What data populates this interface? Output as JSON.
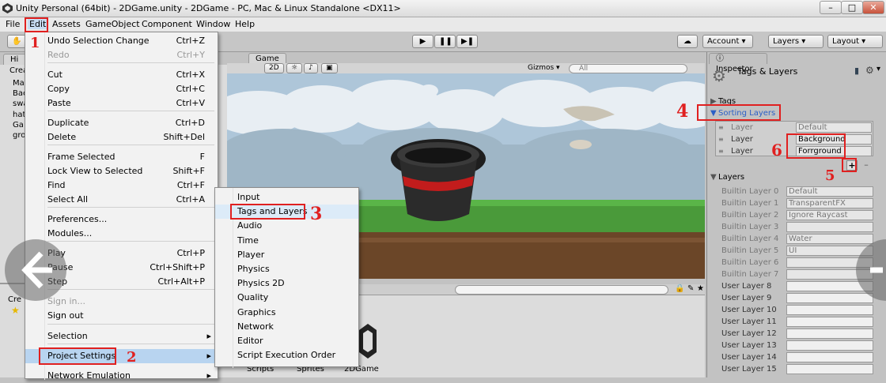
{
  "window": {
    "title": "Unity Personal (64bit) - 2DGame.unity - 2DGame - PC, Mac & Linux Standalone <DX11>",
    "min": "–",
    "max": "□",
    "close": "✕"
  },
  "menubar": [
    "File",
    "Edit",
    "Assets",
    "GameObject",
    "Component",
    "Window",
    "Help"
  ],
  "toolbar": {
    "account": "Account ▾",
    "layers": "Layers ▾",
    "layout": "Layout ▾"
  },
  "tabs": {
    "hierarchy": "Hi",
    "game": "Game",
    "inspector": "Inspector"
  },
  "gamebar": {
    "mode": "2D",
    "gizmos": "Gizmos ▾",
    "search": "All"
  },
  "hierarchy_fragments": [
    "Crea",
    "Ma",
    "Bac",
    "swa",
    "hat",
    "Ga",
    "gro"
  ],
  "project_fragments": [
    "Cre"
  ],
  "edit_menu": [
    {
      "label": "Undo Selection Change",
      "shortcut": "Ctrl+Z",
      "enabled": true
    },
    {
      "label": "Redo",
      "shortcut": "Ctrl+Y",
      "enabled": false
    },
    {
      "label": "Cut",
      "shortcut": "Ctrl+X",
      "enabled": true
    },
    {
      "label": "Copy",
      "shortcut": "Ctrl+C",
      "enabled": true
    },
    {
      "label": "Paste",
      "shortcut": "Ctrl+V",
      "enabled": true
    },
    {
      "label": "Duplicate",
      "shortcut": "Ctrl+D",
      "enabled": true
    },
    {
      "label": "Delete",
      "shortcut": "Shift+Del",
      "enabled": true
    },
    {
      "label": "Frame Selected",
      "shortcut": "F",
      "enabled": true
    },
    {
      "label": "Lock View to Selected",
      "shortcut": "Shift+F",
      "enabled": true
    },
    {
      "label": "Find",
      "shortcut": "Ctrl+F",
      "enabled": true
    },
    {
      "label": "Select All",
      "shortcut": "Ctrl+A",
      "enabled": true
    },
    {
      "label": "Preferences...",
      "shortcut": "",
      "enabled": true
    },
    {
      "label": "Modules...",
      "shortcut": "",
      "enabled": true
    },
    {
      "label": "Play",
      "shortcut": "Ctrl+P",
      "enabled": true
    },
    {
      "label": "Pause",
      "shortcut": "Ctrl+Shift+P",
      "enabled": true
    },
    {
      "label": "Step",
      "shortcut": "Ctrl+Alt+P",
      "enabled": true
    },
    {
      "label": "Sign in...",
      "shortcut": "",
      "enabled": false
    },
    {
      "label": "Sign out",
      "shortcut": "",
      "enabled": true
    },
    {
      "label": "Selection",
      "shortcut": "▸",
      "enabled": true
    },
    {
      "label": "Project Settings",
      "shortcut": "▸",
      "enabled": true
    },
    {
      "label": "Network Emulation",
      "shortcut": "▸",
      "enabled": true
    }
  ],
  "project_settings_menu": [
    "Input",
    "Tags and Layers",
    "Audio",
    "Time",
    "Player",
    "Physics",
    "Physics 2D",
    "Quality",
    "Graphics",
    "Network",
    "Editor",
    "Script Execution Order"
  ],
  "project_folders": [
    "Scripts",
    "Sprites",
    "2DGame"
  ],
  "inspector": {
    "title": "Tags & Layers",
    "tags_label": "Tags",
    "sorting_layers_label": "Sorting Layers",
    "sorting_layers": [
      {
        "label": "Layer",
        "value": "Default",
        "dim": true
      },
      {
        "label": "Layer",
        "value": "Background",
        "dim": false
      },
      {
        "label": "Layer",
        "value": "Forrground",
        "dim": false
      }
    ],
    "add_button": "+",
    "remove_button": "–",
    "layers_label": "Layers",
    "layers": [
      {
        "label": "Builtin Layer 0",
        "value": "Default",
        "dim": true
      },
      {
        "label": "Builtin Layer 1",
        "value": "TransparentFX",
        "dim": true
      },
      {
        "label": "Builtin Layer 2",
        "value": "Ignore Raycast",
        "dim": true
      },
      {
        "label": "Builtin Layer 3",
        "value": "",
        "dim": true
      },
      {
        "label": "Builtin Layer 4",
        "value": "Water",
        "dim": true
      },
      {
        "label": "Builtin Layer 5",
        "value": "UI",
        "dim": true
      },
      {
        "label": "Builtin Layer 6",
        "value": "",
        "dim": true
      },
      {
        "label": "Builtin Layer 7",
        "value": "",
        "dim": true
      },
      {
        "label": "User Layer 8",
        "value": "",
        "dim": false
      },
      {
        "label": "User Layer 9",
        "value": "",
        "dim": false
      },
      {
        "label": "User Layer 10",
        "value": "",
        "dim": false
      },
      {
        "label": "User Layer 11",
        "value": "",
        "dim": false
      },
      {
        "label": "User Layer 12",
        "value": "",
        "dim": false
      },
      {
        "label": "User Layer 13",
        "value": "",
        "dim": false
      },
      {
        "label": "User Layer 14",
        "value": "",
        "dim": false
      },
      {
        "label": "User Layer 15",
        "value": "",
        "dim": false
      }
    ]
  },
  "annotations": [
    "1",
    "2",
    "3",
    "4",
    "5",
    "6"
  ],
  "colors": {
    "highlight": "#b8d4f0",
    "annotation": "#e02020",
    "sky": "#aec6d9",
    "grass": "#4a9a3a",
    "dirt": "#6b4628"
  }
}
